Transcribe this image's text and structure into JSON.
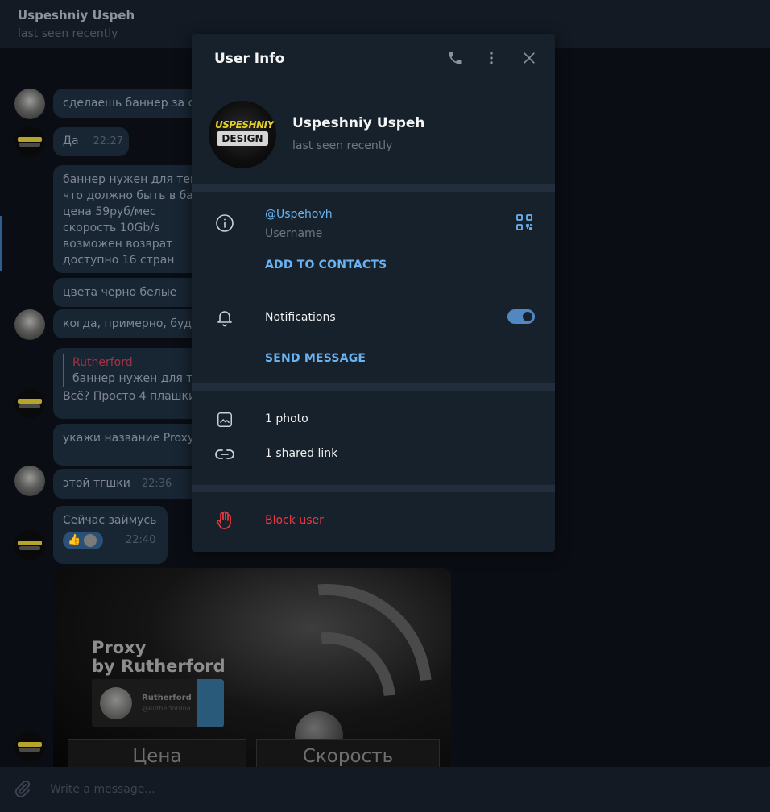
{
  "chat": {
    "title": "Uspeshniy Uspeh",
    "status": "last seen recently",
    "composer_placeholder": "Write a message...",
    "messages": [
      {
        "text": "сделаешь баннер за с"
      },
      {
        "text": "Да",
        "time": "22:27"
      },
      {
        "lines": [
          "баннер нужен для тем",
          "что должно быть в ба",
          "цена 59руб/мес",
          "скорость 10Gb/s",
          "возможен возврат",
          "доступно 16 стран"
        ]
      },
      {
        "text": "цвета черно белые"
      },
      {
        "text": "когда, примерно, буде"
      },
      {
        "quote_author": "Rutherford",
        "quote_text": "баннер нужен для т",
        "text": "Всё? Просто 4 плашки"
      },
      {
        "text": "укажи название Proxy"
      },
      {
        "text": "этой тгшки",
        "time": "22:36"
      },
      {
        "text": "Сейчас займусь",
        "time": "22:40",
        "reaction": "👍"
      }
    ],
    "media": {
      "title_line1": "Proxy",
      "title_line2": "by Rutherford",
      "card_name": "Rutherford",
      "card_handle": "@Rutherfordna",
      "button_price": "Цена",
      "button_speed": "Скорость"
    }
  },
  "modal": {
    "title": "User Info",
    "icons": {
      "call": "phone-icon",
      "more": "more-vertical-icon",
      "close": "close-icon"
    },
    "profile": {
      "name": "Uspeshniy Uspeh",
      "status": "last seen recently",
      "avatar_line1": "USPESHNIY",
      "avatar_line2": "DESIGN"
    },
    "username": "@Uspehovh",
    "username_label": "Username",
    "add_to_contacts": "ADD TO CONTACTS",
    "notifications_label": "Notifications",
    "notifications_on": true,
    "send_message": "SEND MESSAGE",
    "photos": "1 photo",
    "shared_links": "1 shared link",
    "block_user": "Block user",
    "colors": {
      "accent": "#6ab3f3",
      "danger": "#ec3942",
      "toggle": "#5288c1",
      "panel": "#17212b"
    }
  }
}
